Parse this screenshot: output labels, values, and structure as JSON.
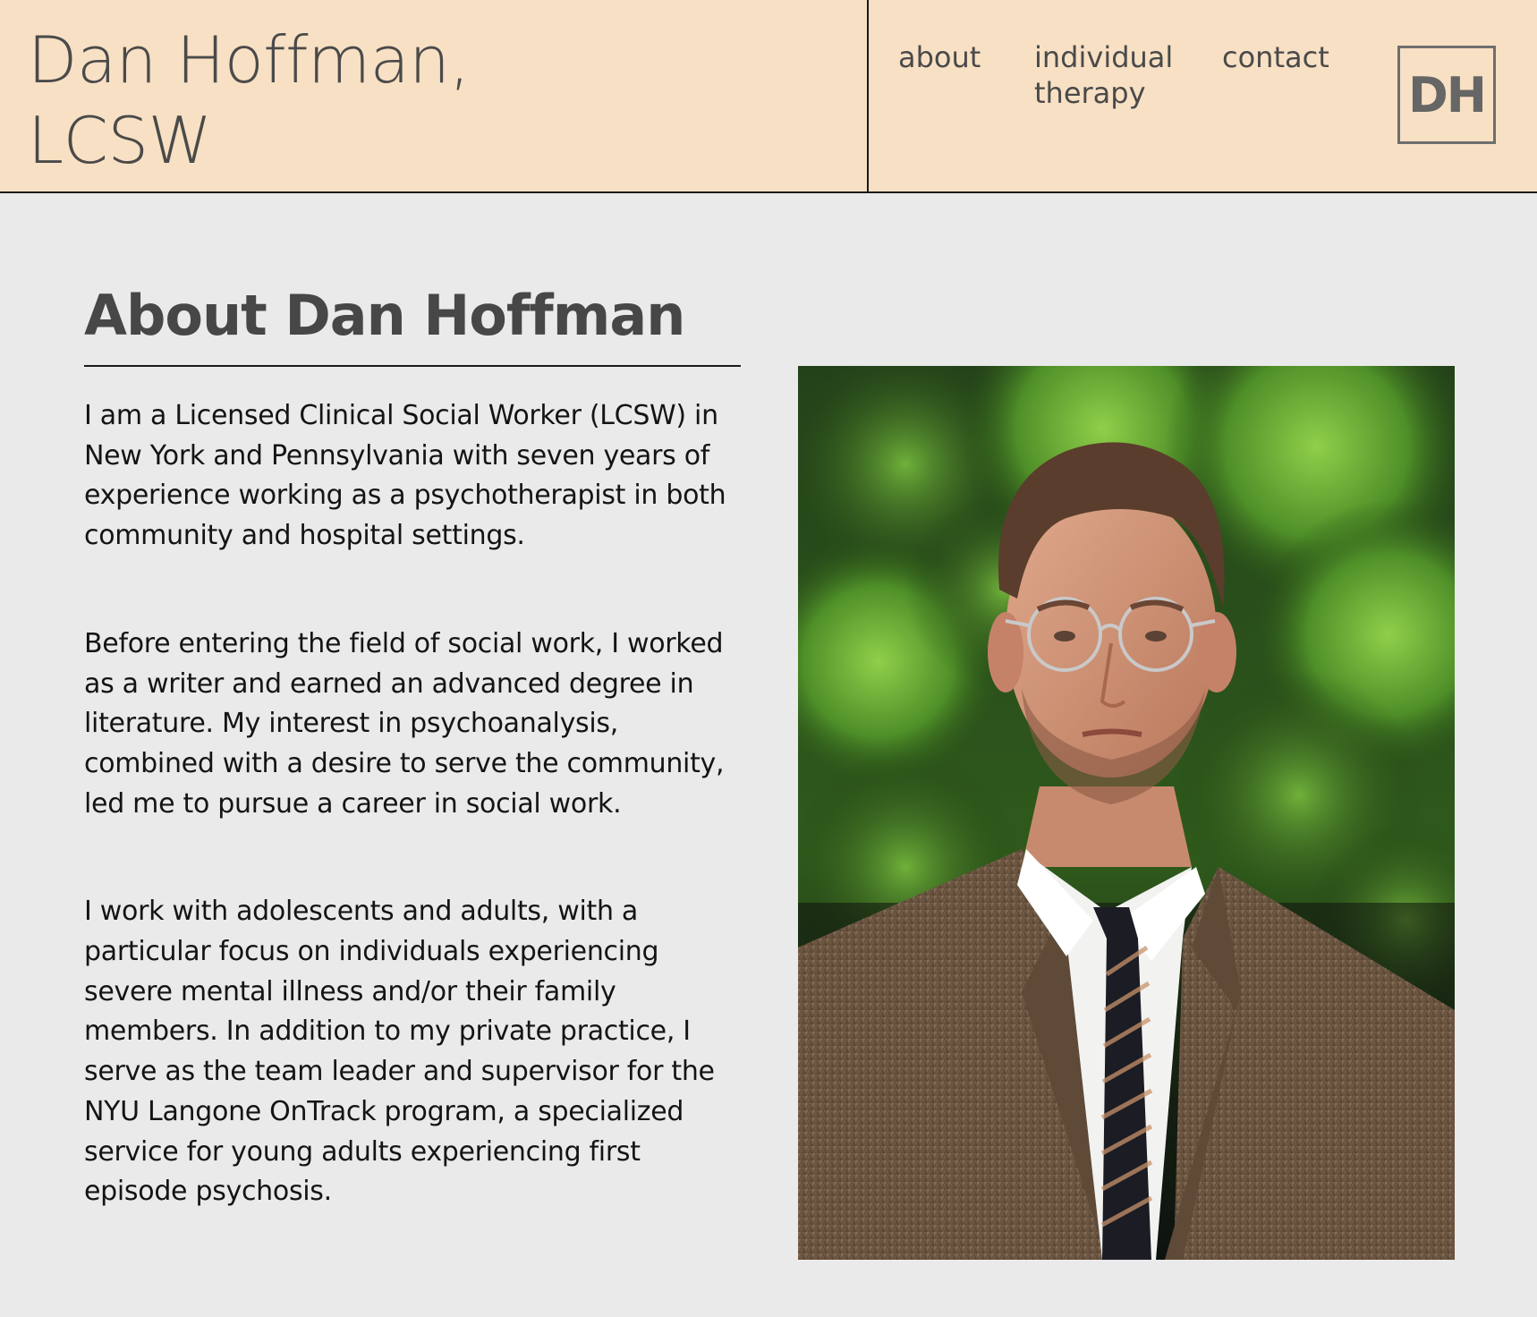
{
  "header": {
    "title_line1": "Dan Hoffman,",
    "title_line2": "LCSW",
    "nav": {
      "about": "about",
      "individual_therapy_line1": "individual",
      "individual_therapy_line2": "therapy",
      "contact": "contact"
    },
    "logo_text": "DH"
  },
  "main": {
    "heading": "About Dan Hoffman",
    "paragraphs": [
      "I am a Licensed Clinical Social Worker (LCSW) in New York and Pennsylvania with seven years of experience working as a psychotherapist in both community and hospital settings.",
      "Before entering the field of social work, I worked as a writer and earned an advanced degree in literature. My interest in psychoanalysis, combined with a desire to serve the community, led me to pursue a career in social work.",
      "I work with adolescents and adults, with a particular focus on individuals experiencing severe mental illness and/or their family members. In addition to my private practice, I serve as the team leader and supervisor for the NYU Langone OnTrack program, a specialized service for young adults experiencing first episode psychosis."
    ]
  },
  "colors": {
    "header_background": "#f8e0c4",
    "page_background": "#eaeaea",
    "text": "#141414",
    "muted_text": "#4a4a4a"
  }
}
